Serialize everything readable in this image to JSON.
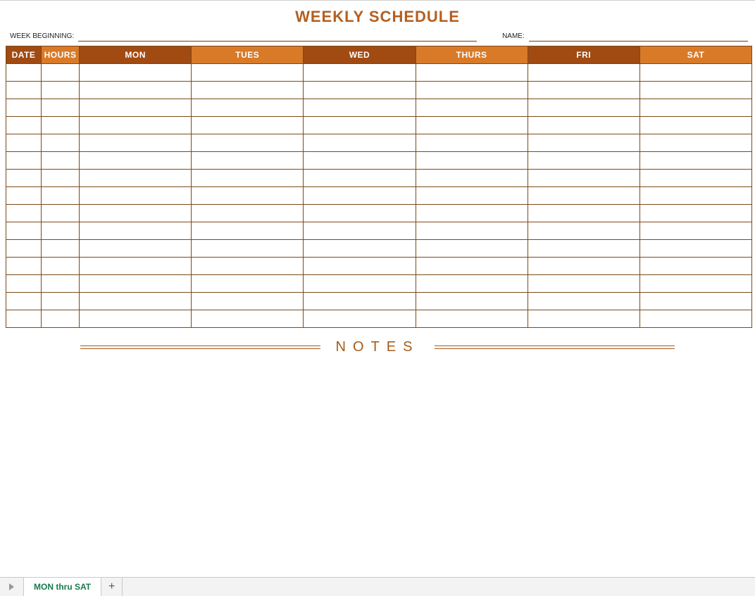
{
  "title": "WEEKLY SCHEDULE",
  "form": {
    "week_beginning_label": "WEEK BEGINNING:",
    "week_beginning_value": "",
    "name_label": "NAME:",
    "name_value": ""
  },
  "table": {
    "headers": {
      "date": "DATE",
      "hours": "HOURS",
      "mon": "MON",
      "tues": "TUES",
      "wed": "WED",
      "thurs": "THURS",
      "fri": "FRI",
      "sat": "SAT"
    },
    "rows": [
      {
        "date": "",
        "hours": "",
        "mon": "",
        "tues": "",
        "wed": "",
        "thurs": "",
        "fri": "",
        "sat": ""
      },
      {
        "date": "",
        "hours": "",
        "mon": "",
        "tues": "",
        "wed": "",
        "thurs": "",
        "fri": "",
        "sat": ""
      },
      {
        "date": "",
        "hours": "",
        "mon": "",
        "tues": "",
        "wed": "",
        "thurs": "",
        "fri": "",
        "sat": ""
      },
      {
        "date": "",
        "hours": "",
        "mon": "",
        "tues": "",
        "wed": "",
        "thurs": "",
        "fri": "",
        "sat": ""
      },
      {
        "date": "",
        "hours": "",
        "mon": "",
        "tues": "",
        "wed": "",
        "thurs": "",
        "fri": "",
        "sat": ""
      },
      {
        "date": "",
        "hours": "",
        "mon": "",
        "tues": "",
        "wed": "",
        "thurs": "",
        "fri": "",
        "sat": ""
      },
      {
        "date": "",
        "hours": "",
        "mon": "",
        "tues": "",
        "wed": "",
        "thurs": "",
        "fri": "",
        "sat": ""
      },
      {
        "date": "",
        "hours": "",
        "mon": "",
        "tues": "",
        "wed": "",
        "thurs": "",
        "fri": "",
        "sat": ""
      },
      {
        "date": "",
        "hours": "",
        "mon": "",
        "tues": "",
        "wed": "",
        "thurs": "",
        "fri": "",
        "sat": ""
      },
      {
        "date": "",
        "hours": "",
        "mon": "",
        "tues": "",
        "wed": "",
        "thurs": "",
        "fri": "",
        "sat": ""
      },
      {
        "date": "",
        "hours": "",
        "mon": "",
        "tues": "",
        "wed": "",
        "thurs": "",
        "fri": "",
        "sat": ""
      },
      {
        "date": "",
        "hours": "",
        "mon": "",
        "tues": "",
        "wed": "",
        "thurs": "",
        "fri": "",
        "sat": ""
      },
      {
        "date": "",
        "hours": "",
        "mon": "",
        "tues": "",
        "wed": "",
        "thurs": "",
        "fri": "",
        "sat": ""
      },
      {
        "date": "",
        "hours": "",
        "mon": "",
        "tues": "",
        "wed": "",
        "thurs": "",
        "fri": "",
        "sat": ""
      },
      {
        "date": "",
        "hours": "",
        "mon": "",
        "tues": "",
        "wed": "",
        "thurs": "",
        "fri": "",
        "sat": ""
      }
    ]
  },
  "notes_label": "NOTES",
  "tabs": {
    "active": "MON thru SAT",
    "add": "+"
  }
}
